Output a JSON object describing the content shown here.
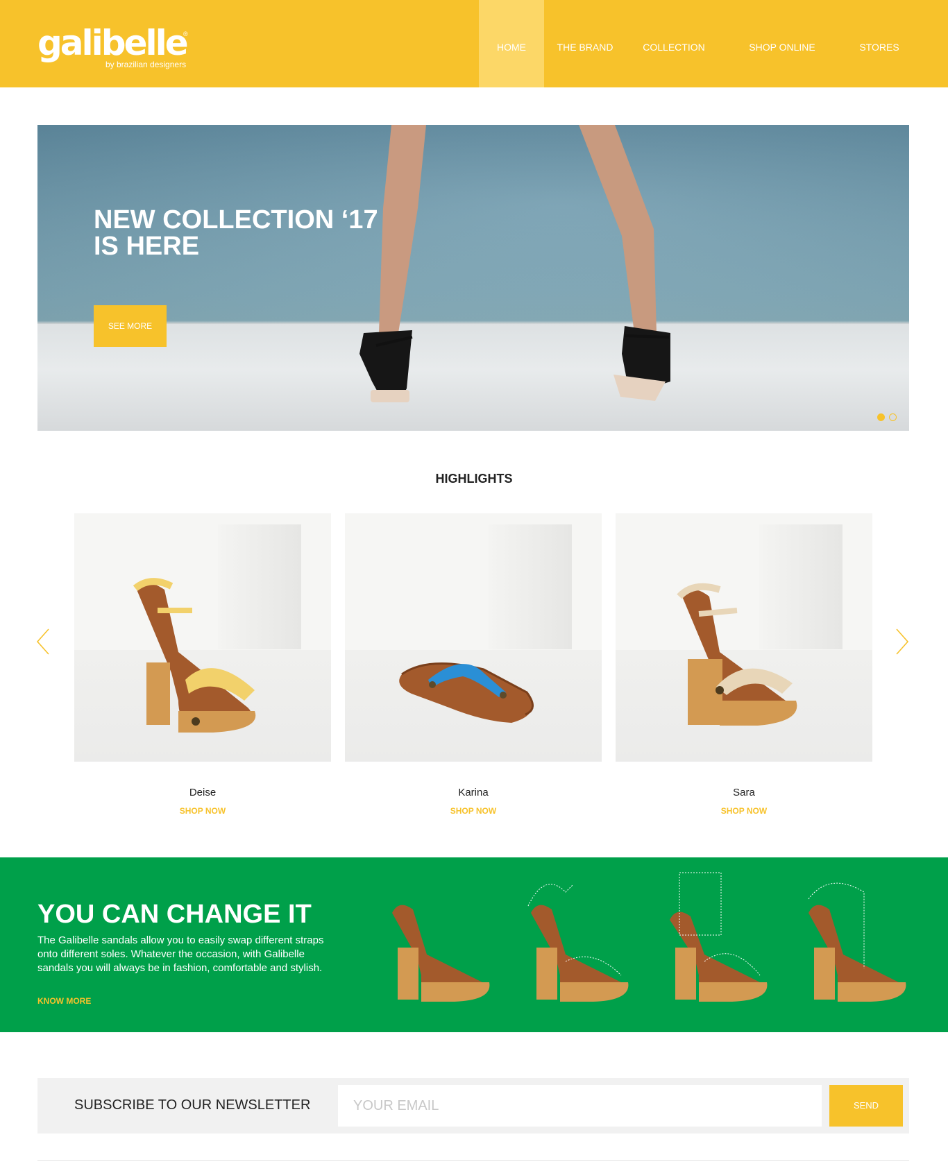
{
  "brand": {
    "name": "galibelle",
    "registered": "®",
    "tagline": "by brazilian designers"
  },
  "nav": {
    "items": [
      {
        "label": "HOME",
        "active": true
      },
      {
        "label": "THE BRAND",
        "active": false
      },
      {
        "label": "COLLECTION",
        "active": false
      },
      {
        "label": "SHOP ONLINE",
        "active": false
      },
      {
        "label": "STORES",
        "active": false
      }
    ]
  },
  "hero": {
    "title_line1": "NEW COLLECTION ‘17",
    "title_line2": "IS HERE",
    "button_label": "SEE MORE",
    "slides_total": 2,
    "active_slide": 1
  },
  "highlights": {
    "title": "HIGHLIGHTS",
    "prev_icon": "chevron-left-icon",
    "next_icon": "chevron-right-icon",
    "products": [
      {
        "name": "Deise",
        "cta": "SHOP NOW",
        "strap_color": "#f2d16b"
      },
      {
        "name": "Karina",
        "cta": "SHOP NOW",
        "strap_color": "#2a8fd6"
      },
      {
        "name": "Sara",
        "cta": "SHOP NOW",
        "strap_color": "#e8d6b8"
      }
    ]
  },
  "change": {
    "title": "YOU CAN CHANGE IT",
    "text": "The Galibelle sandals allow you to easily swap different straps onto different soles. Whatever the occasion, with Galibelle sandals you will always be in fashion, comfortable and stylish.",
    "link_label": "KNOW MORE"
  },
  "newsletter": {
    "label": "SUBSCRIBE TO OUR NEWSLETTER",
    "placeholder": "YOUR EMAIL",
    "value": "",
    "button_label": "SEND"
  },
  "colors": {
    "accent": "#f7c22b",
    "nav_active": "#fcd767",
    "green": "#00a04a",
    "cork": "#d39a52",
    "leather": "#a35a2c"
  }
}
